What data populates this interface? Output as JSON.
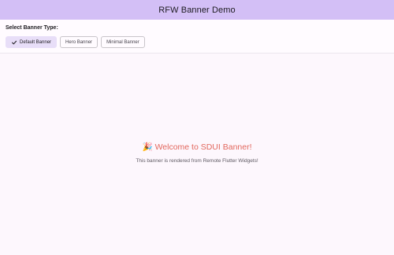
{
  "appbar": {
    "title": "RFW Banner Demo"
  },
  "selector": {
    "label": "Select Banner Type:",
    "chips": [
      {
        "label": "Default Banner",
        "selected": true
      },
      {
        "label": "Hero Banner",
        "selected": false
      },
      {
        "label": "Minimal Banner",
        "selected": false
      }
    ]
  },
  "banner": {
    "icon": "party-popper-icon",
    "emoji": "🎉",
    "title": "Welcome to SDUI Banner!",
    "subtitle": "This banner is rendered from Remote Flutter Widgets!"
  },
  "colors": {
    "appbar": "#d3bff6",
    "selected_chip": "#e8def8",
    "title_accent": "#e2675d",
    "background": "#fdf7fd"
  }
}
